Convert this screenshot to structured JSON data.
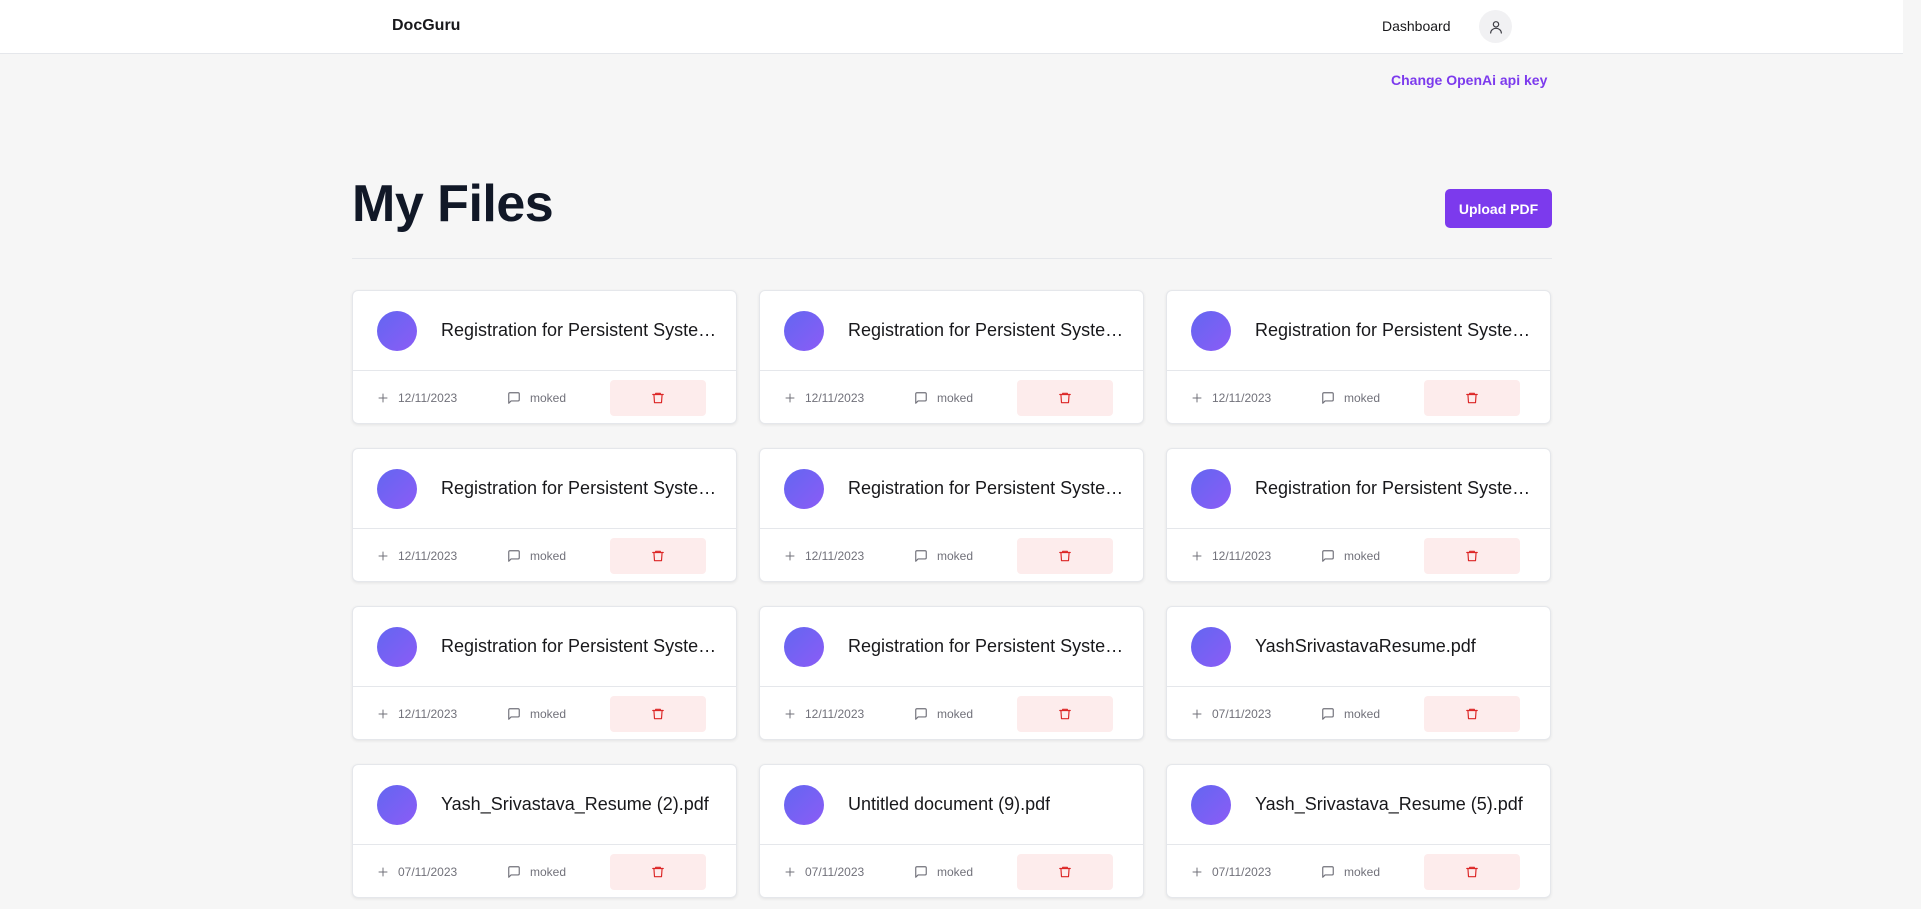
{
  "navbar": {
    "brand": "DocGuru",
    "dashboard_label": "Dashboard",
    "avatar_icon": "user-icon"
  },
  "api_key_link": "Change OpenAi api key",
  "page_title": "My Files",
  "upload_button": "Upload PDF",
  "colors": {
    "accent": "#7c3aed",
    "delete_bg": "#fdecec",
    "delete_icon": "#dc2626"
  },
  "files": [
    {
      "name": "Registration for Persistent Systems.pdf",
      "date": "12/11/2023",
      "chat": "moked"
    },
    {
      "name": "Registration for Persistent Systems.pdf",
      "date": "12/11/2023",
      "chat": "moked"
    },
    {
      "name": "Registration for Persistent Systems.pdf",
      "date": "12/11/2023",
      "chat": "moked"
    },
    {
      "name": "Registration for Persistent Systems.pdf",
      "date": "12/11/2023",
      "chat": "moked"
    },
    {
      "name": "Registration for Persistent Systems.pdf",
      "date": "12/11/2023",
      "chat": "moked"
    },
    {
      "name": "Registration for Persistent Systems.pdf",
      "date": "12/11/2023",
      "chat": "moked"
    },
    {
      "name": "Registration for Persistent Systems.pdf",
      "date": "12/11/2023",
      "chat": "moked"
    },
    {
      "name": "Registration for Persistent Systems.pdf",
      "date": "12/11/2023",
      "chat": "moked"
    },
    {
      "name": "YashSrivastavaResume.pdf",
      "date": "07/11/2023",
      "chat": "moked"
    },
    {
      "name": "Yash_Srivastava_Resume (2).pdf",
      "date": "07/11/2023",
      "chat": "moked"
    },
    {
      "name": "Untitled document (9).pdf",
      "date": "07/11/2023",
      "chat": "moked"
    },
    {
      "name": "Yash_Srivastava_Resume (5).pdf",
      "date": "07/11/2023",
      "chat": "moked"
    }
  ]
}
